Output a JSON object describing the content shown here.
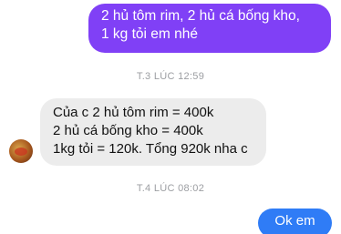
{
  "messages": {
    "outgoing_1": {
      "line1": "2 hủ tôm rim, 2 hủ cá bống kho,",
      "line2": "1 kg tỏi em nhé"
    },
    "timestamp_1": "T.3 LÚC 12:59",
    "incoming_1": {
      "line1": "Của c 2 hủ tôm rim = 400k",
      "line2": "2 hủ cá bống kho = 400k",
      "line3": "1kg tỏi = 120k. Tổng 920k nha c"
    },
    "timestamp_2": "T.4 LÚC 08:02",
    "outgoing_2": "Ok em"
  },
  "colors": {
    "outgoing_purple": "#8040f6",
    "outgoing_blue": "#2f7cf6",
    "incoming_gray": "#ececec",
    "timestamp_gray": "#9c9ea2"
  }
}
